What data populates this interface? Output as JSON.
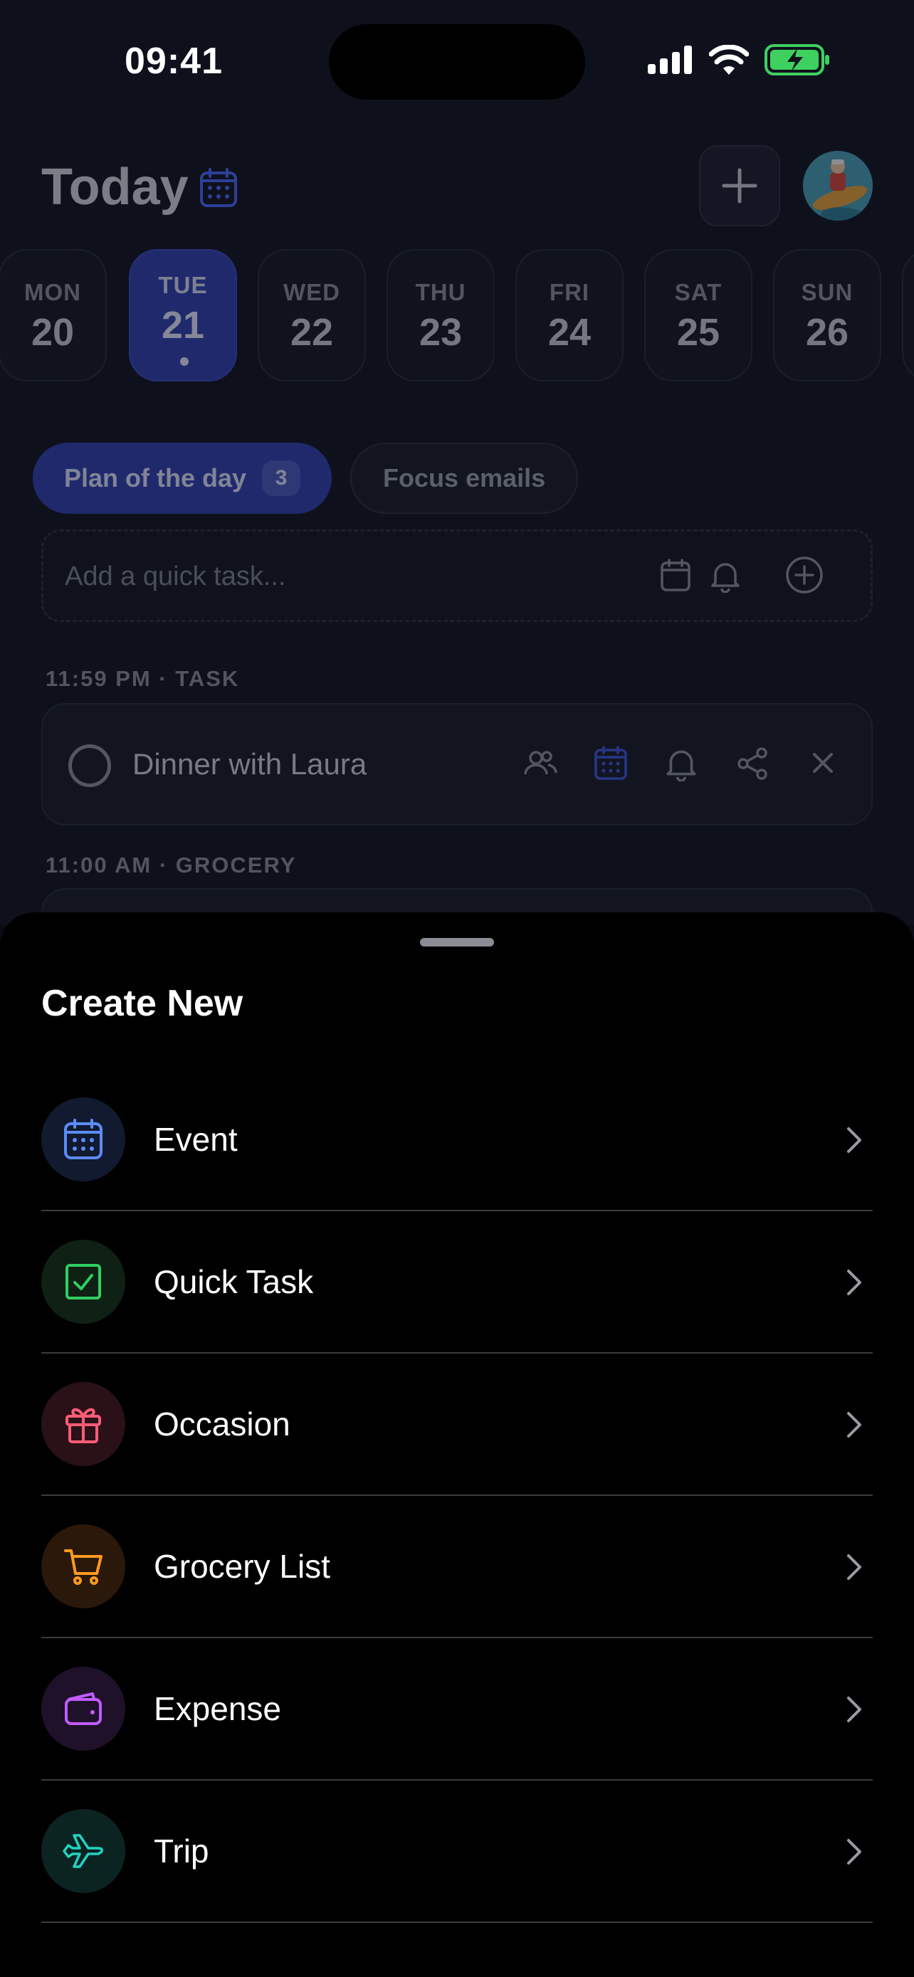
{
  "status_bar": {
    "time": "09:41"
  },
  "header": {
    "title": "Today"
  },
  "days": [
    {
      "name": "MON",
      "num": "20"
    },
    {
      "name": "TUE",
      "num": "21",
      "active": true
    },
    {
      "name": "WED",
      "num": "22"
    },
    {
      "name": "THU",
      "num": "23"
    },
    {
      "name": "FRI",
      "num": "24"
    },
    {
      "name": "SAT",
      "num": "25"
    },
    {
      "name": "SUN",
      "num": "26"
    }
  ],
  "tabs": {
    "plan_label": "Plan of the day",
    "plan_count": "3",
    "focus_label": "Focus emails"
  },
  "quick_add": {
    "placeholder": "Add a quick task..."
  },
  "sections": [
    {
      "label": "11:59 PM · TASK"
    },
    {
      "label": "11:00 AM · GROCERY"
    }
  ],
  "task": {
    "title": "Dinner with Laura"
  },
  "sheet": {
    "title": "Create New",
    "items": [
      {
        "label": "Event",
        "icon": "calendar-icon",
        "color": "#5b8cff",
        "bg": "#111a2e"
      },
      {
        "label": "Quick Task",
        "icon": "checkbox-icon",
        "color": "#2fd060",
        "bg": "#0f2015"
      },
      {
        "label": "Occasion",
        "icon": "gift-icon",
        "color": "#ff5c78",
        "bg": "#2a1117"
      },
      {
        "label": "Grocery List",
        "icon": "cart-icon",
        "color": "#ff9a1f",
        "bg": "#2a180a"
      },
      {
        "label": "Expense",
        "icon": "wallet-icon",
        "color": "#c15cff",
        "bg": "#20112a"
      },
      {
        "label": "Trip",
        "icon": "airplane-icon",
        "color": "#22d3c0",
        "bg": "#0b2422"
      }
    ]
  },
  "colors": {
    "accent": "#2e3fb0",
    "sheet_bg": "#000000",
    "app_bg": "#0e111c"
  }
}
